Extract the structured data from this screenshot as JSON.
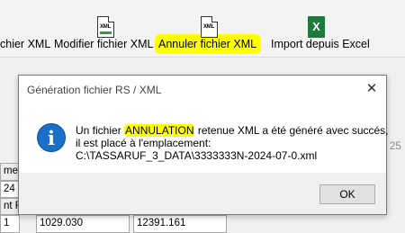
{
  "toolbar": {
    "items": [
      {
        "label": "chier XML",
        "icon": "xml-file-icon",
        "tag": ""
      },
      {
        "label": "Modifier fichier XML",
        "icon": "xml-file-edit-icon",
        "tag": "XML"
      },
      {
        "label": "Annuler fichier XML",
        "icon": "xml-file-cancel-icon",
        "tag": "XML",
        "highlight": "#ffff00"
      },
      {
        "label": "Import depuis Excel",
        "icon": "excel-icon",
        "tag": "X"
      }
    ]
  },
  "grid": {
    "cells": [
      "ment",
      "24",
      "nt RS",
      "1",
      "1029.030",
      "12391.161",
      "25"
    ]
  },
  "dialog": {
    "title": "Génération fichier RS / XML",
    "close_label": "✕",
    "icon": "info-icon",
    "icon_glyph": "i",
    "message": {
      "line1_before": "Un fichier ",
      "line1_highlight": "ANNULATION",
      "line1_after": " retenue XML a été généré avec succés,",
      "line2": "il est placé à l'emplacement:",
      "line3": "C:\\TASSARUF_3_DATA\\3333333N-2024-07-0.xml"
    },
    "ok_label": "OK"
  },
  "colors": {
    "highlight": "#ffff00",
    "info_blue": "#1a6fc9",
    "excel_green": "#1e7a3c"
  }
}
